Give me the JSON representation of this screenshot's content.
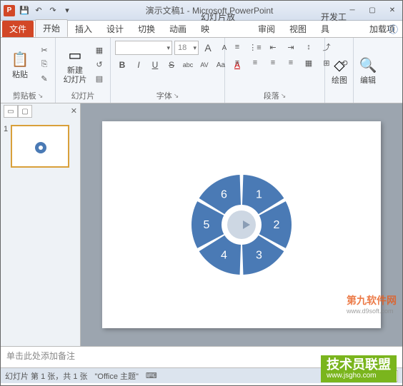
{
  "window": {
    "title": "演示文稿1 - Microsoft PowerPoint",
    "app_icon": "P"
  },
  "qat": {
    "save": "💾",
    "undo": "↶",
    "redo": "↷",
    "more": "▾"
  },
  "tabs": {
    "file": "文件",
    "home": "开始",
    "insert": "插入",
    "design": "设计",
    "transitions": "切换",
    "animations": "动画",
    "slideshow": "幻灯片放映",
    "review": "审阅",
    "view": "视图",
    "developer": "开发工具",
    "addins": "加载项"
  },
  "help_icon": "ⓘ",
  "ribbon": {
    "clipboard": {
      "label": "剪贴板",
      "paste": "粘贴",
      "paste_icon": "📋",
      "cut": "✂",
      "copy": "⎘",
      "format_painter": "✎"
    },
    "slides": {
      "label": "幻灯片",
      "new_slide": "新建\n幻灯片",
      "icon": "▭",
      "layout": "▦",
      "reset": "↺",
      "section": "▤"
    },
    "font": {
      "label": "字体",
      "name_placeholder": "",
      "size_placeholder": "18",
      "grow": "A",
      "shrink": "A",
      "bold": "B",
      "italic": "I",
      "underline": "U",
      "strike": "S",
      "shadow": "abc",
      "spacing": "AV",
      "case": "Aa",
      "color": "A"
    },
    "paragraph": {
      "label": "段落",
      "bullets": "≡",
      "numbering": "⋮≡",
      "indent_dec": "⇤",
      "indent_inc": "⇥",
      "line_spacing": "↕",
      "align_left": "≡",
      "align_center": "≡",
      "align_right": "≡",
      "justify": "≡",
      "columns": "▦",
      "direction": "⤴",
      "align_obj": "⊞",
      "smartart": "⟲"
    },
    "drawing": {
      "label": "绘图",
      "icon": "◇"
    },
    "editing": {
      "label": "编辑",
      "icon": "🔍"
    }
  },
  "thumbs": {
    "tab1": "▭",
    "tab2": "▢",
    "close": "✕",
    "num1": "1"
  },
  "chart_data": {
    "type": "pie",
    "title": "",
    "segments": [
      {
        "label": "1",
        "value": 1
      },
      {
        "label": "2",
        "value": 1
      },
      {
        "label": "3",
        "value": 1
      },
      {
        "label": "4",
        "value": 1
      },
      {
        "label": "5",
        "value": 1
      },
      {
        "label": "6",
        "value": 1
      }
    ],
    "color": "#4a7ab5",
    "center": "arrow"
  },
  "notes": {
    "placeholder": "单击此处添加备注"
  },
  "status": {
    "slide_info": "幻灯片 第 1 张，共 1 张",
    "theme": "\"Office 主题\"",
    "lang": "⌨",
    "zoom": ""
  },
  "watermarks": {
    "w1_main": "第九软件网",
    "w1_sub": "www.d9soft.com",
    "w2_main": "技术员联盟",
    "w2_url": "www.jsgho.com"
  }
}
